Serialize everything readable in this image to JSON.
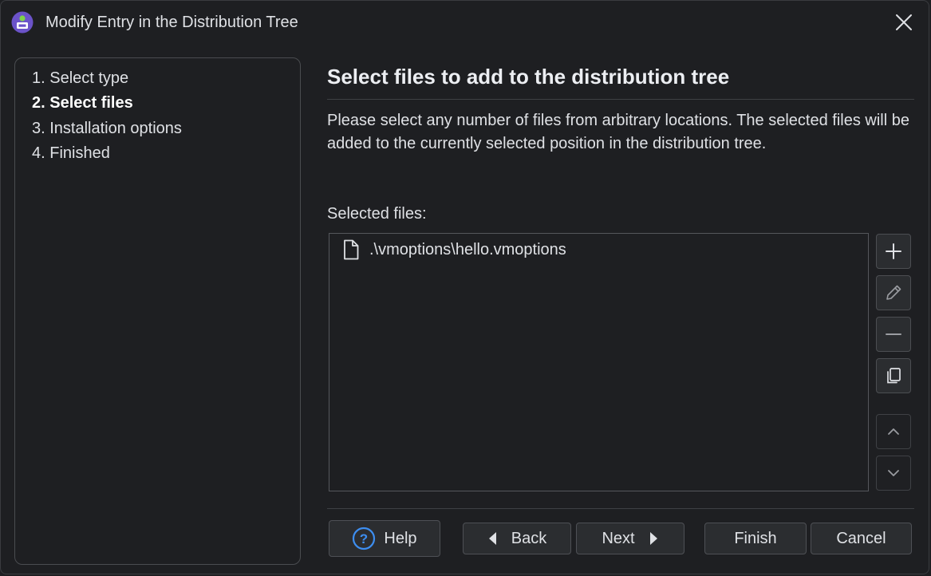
{
  "window": {
    "title": "Modify Entry in the Distribution Tree"
  },
  "steps": [
    {
      "label": "1. Select type",
      "active": false
    },
    {
      "label": "2. Select files",
      "active": true
    },
    {
      "label": "3. Installation options",
      "active": false
    },
    {
      "label": "4. Finished",
      "active": false
    }
  ],
  "main": {
    "heading": "Select files to add to the distribution tree",
    "description": "Please select any number of files from arbitrary locations. The selected files will be added to the currently selected position in the distribution tree.",
    "files_label": "Selected files:",
    "files": [
      {
        "name": ".\\vmoptions\\hello.vmoptions",
        "icon": "file-icon"
      }
    ]
  },
  "side_buttons": [
    {
      "name": "add-button",
      "icon": "plus-icon",
      "enabled": true
    },
    {
      "name": "edit-button",
      "icon": "pencil-icon",
      "enabled": true
    },
    {
      "name": "remove-button",
      "icon": "minus-icon",
      "enabled": true
    },
    {
      "name": "copy-button",
      "icon": "copy-icon",
      "enabled": true
    },
    {
      "name": "move-up-button",
      "icon": "chevron-up-icon",
      "enabled": false
    },
    {
      "name": "move-down-button",
      "icon": "chevron-down-icon",
      "enabled": false
    }
  ],
  "buttons": {
    "help": "Help",
    "back": "Back",
    "next": "Next",
    "finish": "Finish",
    "cancel": "Cancel"
  },
  "colors": {
    "background": "#1e1f22",
    "button": "#2b2d30",
    "border": "#4e5055",
    "text": "#dfe1e5",
    "accent": "#3d8ef0"
  }
}
